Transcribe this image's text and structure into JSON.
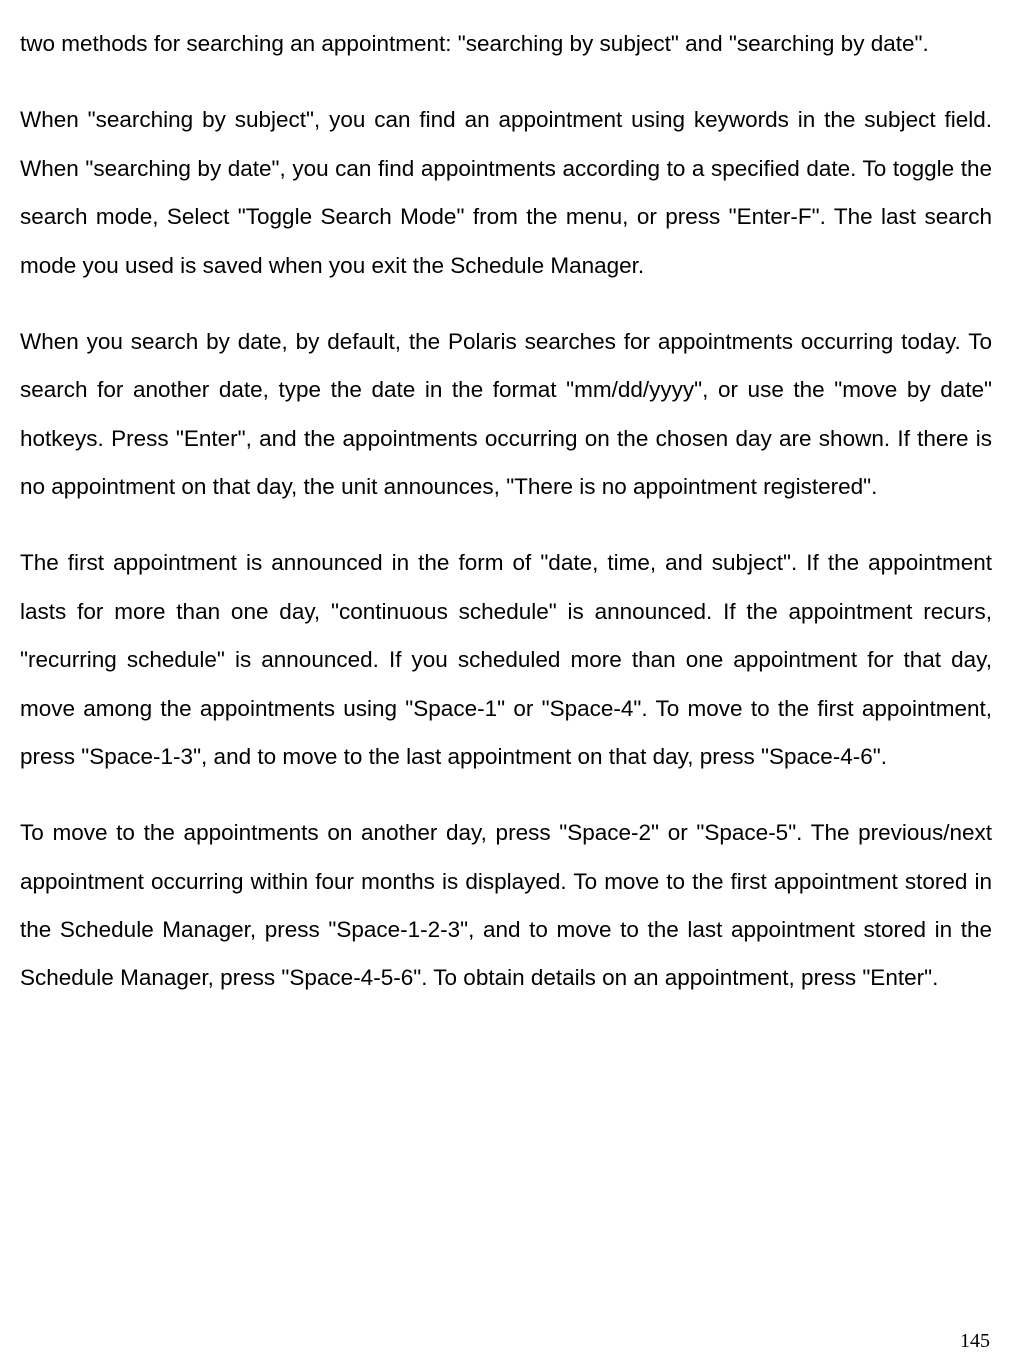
{
  "paragraphs": {
    "p1": "two methods for searching an appointment: \"searching by subject\" and \"searching by date\".",
    "p2": "When \"searching by subject\", you can find an appointment using keywords in the subject field. When \"searching by date\", you can find appointments according to a specified date. To toggle the search mode, Select \"Toggle Search Mode\" from the menu, or press \"Enter-F\". The last search mode you used is saved when you exit the Schedule Manager.",
    "p3": "When you search by date, by default, the Polaris searches for appointments occurring today. To search for another date, type the date in the format \"mm/dd/yyyy\", or use the \"move by date\" hotkeys. Press \"Enter\", and the appointments occurring on the chosen day are shown. If there is no appointment on that day, the unit announces, \"There is no appointment registered\".",
    "p4": "The first appointment is announced in the form of \"date, time, and subject\". If the appointment lasts for more than one day, \"continuous schedule\" is announced. If the appointment recurs, \"recurring schedule\" is announced. If you scheduled more than one appointment for that day, move among the appointments using \"Space-1\" or \"Space-4\". To move to the first appointment, press \"Space-1-3\", and to move to the last appointment on that day, press \"Space-4-6\".",
    "p5": "To move to the appointments on another day, press \"Space-2\" or \"Space-5\". The previous/next appointment occurring within four months is displayed. To move to the first appointment stored in the Schedule Manager, press \"Space-1-2-3\", and to move to the last appointment stored in the Schedule Manager, press \"Space-4-5-6\". To obtain details on an appointment, press \"Enter\"."
  },
  "pageNumber": "145"
}
